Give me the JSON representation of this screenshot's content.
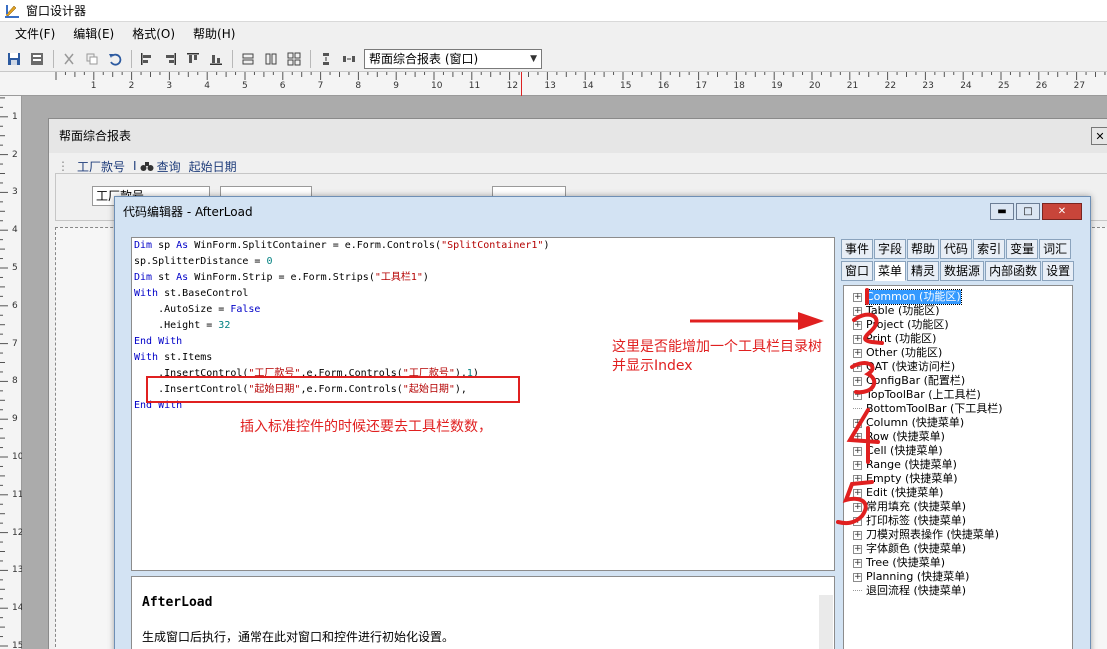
{
  "window": {
    "title": "窗口设计器"
  },
  "menu": {
    "items": [
      "文件(F)",
      "编辑(E)",
      "格式(O)",
      "帮助(H)"
    ]
  },
  "toolbar": {
    "combo_value": "帮面综合报表 (窗口)"
  },
  "ruler": {
    "h_labels": [
      "1",
      "2",
      "3",
      "4",
      "5",
      "6",
      "7",
      "8",
      "9",
      "10",
      "11",
      "12",
      "13",
      "14",
      "15",
      "16",
      "17",
      "18",
      "19",
      "20",
      "21",
      "22",
      "23",
      "24",
      "25",
      "26",
      "27"
    ],
    "v_labels": [
      "1",
      "2",
      "3",
      "4",
      "5",
      "6",
      "7",
      "8",
      "9",
      "10",
      "11",
      "12",
      "13",
      "14",
      "15"
    ]
  },
  "form": {
    "title": "帮面综合报表",
    "toolbar_items": [
      "工厂款号",
      "查询",
      "起始日期"
    ],
    "input_value": "工厂款号"
  },
  "dialog": {
    "title": "代码编辑器 - AfterLoad",
    "code_lines": [
      "Dim sp As WinForm.SplitContainer = e.Form.Controls(\"SplitContainer1\")",
      "sp.SplitterDistance = 0",
      "Dim st As WinForm.Strip = e.Form.Strips(\"工具栏1\")",
      "With st.BaseControl",
      "    .AutoSize = False",
      "    .Height = 32",
      "End With",
      "With st.Items",
      "    .InsertControl(\"工厂款号\",e.Form.Controls(\"工厂款号\"),1)",
      "    .InsertControl(\"起始日期\",e.Form.Controls(\"起始日期\"),",
      "End With"
    ],
    "desc_title": "AfterLoad",
    "desc_text": "生成窗口后执行，通常在此对窗口和控件进行初始化设置。",
    "tabs_row1": [
      "事件",
      "字段",
      "帮助",
      "代码",
      "索引",
      "变量",
      "词汇"
    ],
    "tabs_row2": [
      "窗口",
      "菜单",
      "精灵",
      "数据源",
      "内部函数",
      "设置"
    ],
    "active_tab": "菜单",
    "tree": [
      {
        "label": "Common (功能区)",
        "exp": true,
        "selected": true
      },
      {
        "label": "Table (功能区)",
        "exp": true
      },
      {
        "label": "Project (功能区)",
        "exp": true
      },
      {
        "label": "Print (功能区)",
        "exp": true
      },
      {
        "label": "Other (功能区)",
        "exp": true
      },
      {
        "label": "QAT (快速访问栏)",
        "exp": true
      },
      {
        "label": "ConfigBar (配置栏)",
        "exp": true
      },
      {
        "label": "TopToolBar (上工具栏)",
        "exp": true
      },
      {
        "label": "BottomToolBar (下工具栏)",
        "exp": false
      },
      {
        "label": "Column (快捷菜单)",
        "exp": true
      },
      {
        "label": "Row (快捷菜单)",
        "exp": true
      },
      {
        "label": "Cell (快捷菜单)",
        "exp": true
      },
      {
        "label": "Range (快捷菜单)",
        "exp": true
      },
      {
        "label": "Empty (快捷菜单)",
        "exp": true
      },
      {
        "label": "Edit (快捷菜单)",
        "exp": true
      },
      {
        "label": "常用填充 (快捷菜单)",
        "exp": true
      },
      {
        "label": "打印标签 (快捷菜单)",
        "exp": true
      },
      {
        "label": "刀模对照表操作 (快捷菜单)",
        "exp": true
      },
      {
        "label": "字体颜色 (快捷菜单)",
        "exp": true
      },
      {
        "label": "Tree (快捷菜单)",
        "exp": true
      },
      {
        "label": "Planning (快捷菜单)",
        "exp": true
      },
      {
        "label": "退回流程 (快捷菜单)",
        "exp": false
      }
    ]
  },
  "annotations": {
    "note1": "插入标准控件的时候还要去工具栏数数，",
    "note2_line1": "这里是否能增加一个工具栏目录树",
    "note2_line2": "并显示Index"
  },
  "colors": {
    "annotation": "#e02020",
    "selection": "#3399ff"
  }
}
